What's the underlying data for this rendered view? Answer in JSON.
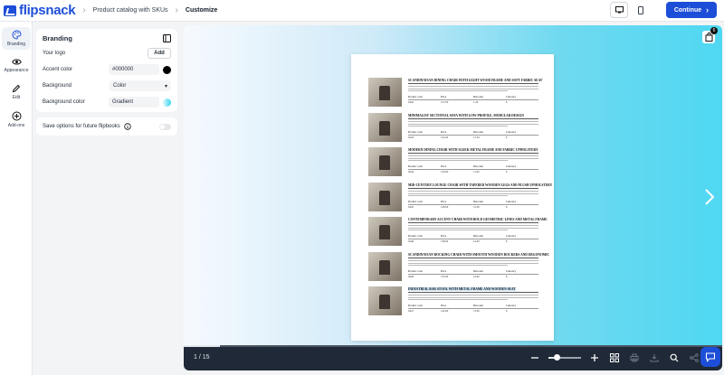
{
  "header": {
    "logo_text": "flipsnack",
    "breadcrumb": [
      "Product catalog with SKUs",
      "Customize"
    ],
    "continue_label": "Continue"
  },
  "rail": {
    "items": [
      {
        "label": "Branding",
        "icon": "palette-icon",
        "active": true
      },
      {
        "label": "Appearance",
        "icon": "eye-icon",
        "active": false
      },
      {
        "label": "Edit",
        "icon": "pencil-icon",
        "active": false
      },
      {
        "label": "Add-ons",
        "icon": "plus-circle-icon",
        "active": false
      }
    ]
  },
  "branding": {
    "title": "Branding",
    "logo_label": "Your logo",
    "add_label": "Add",
    "accent_label": "Accent color",
    "accent_value": "#000000",
    "accent_color": "#000000",
    "background_label": "Background",
    "background_value": "Color",
    "bgcolor_label": "Background color",
    "bgcolor_value": "Gradient"
  },
  "save_options": {
    "label": "Save options for future flipbooks",
    "enabled": false
  },
  "cart": {
    "count": "6"
  },
  "catalog": {
    "products": [
      {
        "title": "SCANDINAVIAN DINING CHAIR WITH LIGHT WOOD FRAME AND SOFT FABRIC SEAT",
        "code": "0442",
        "price": "127.00",
        "discount": "1.20",
        "currency": "$",
        "highlight": false
      },
      {
        "title": "MINIMALIST SECTIONAL SOFA WITH LOW-PROFILE, MODULAR DESIGN",
        "code": "0443",
        "price": "142.00",
        "discount": "13.50",
        "currency": "$",
        "highlight": false
      },
      {
        "title": "MODERN DINING CHAIR WITH SLEEK METAL FRAME AND FABRIC UPHOLSTERY",
        "code": "0444",
        "price": "139.00",
        "discount": "11.00",
        "currency": "$",
        "highlight": false
      },
      {
        "title": "MID-CENTURY LOUNGE CHAIR WITH TAPERED WOODEN LEGS AND PLUSH UPHOLSTERY",
        "code": "0445",
        "price": "148.00",
        "discount": "12.00",
        "currency": "$",
        "highlight": false
      },
      {
        "title": "CONTEMPORARY ACCENT CHAIR WITH BOLD GEOMETRIC LINES AND METAL FRAME",
        "code": "0446",
        "price": "138.00",
        "discount": "14.00",
        "currency": "$",
        "highlight": false
      },
      {
        "title": "SCANDINAVIAN ROCKING CHAIR WITH SMOOTH WOODEN ROCKERS AND ERGONOMIC",
        "code": "0446",
        "price": "135.00",
        "discount": "16.00",
        "currency": "$",
        "highlight": false
      },
      {
        "title": "INDUSTRIAL BAR STOOL WITH METAL FRAME AND WOODEN SEAT",
        "code": "0447",
        "price": "142.00",
        "discount": "13.00",
        "currency": "$",
        "highlight": true
      }
    ],
    "col_headers": [
      "Product code",
      "Price",
      "Discount",
      "Currency"
    ]
  },
  "viewer": {
    "page_indicator": "1 / 15",
    "zoom_level": 0.25,
    "page_progress": 0.067
  }
}
